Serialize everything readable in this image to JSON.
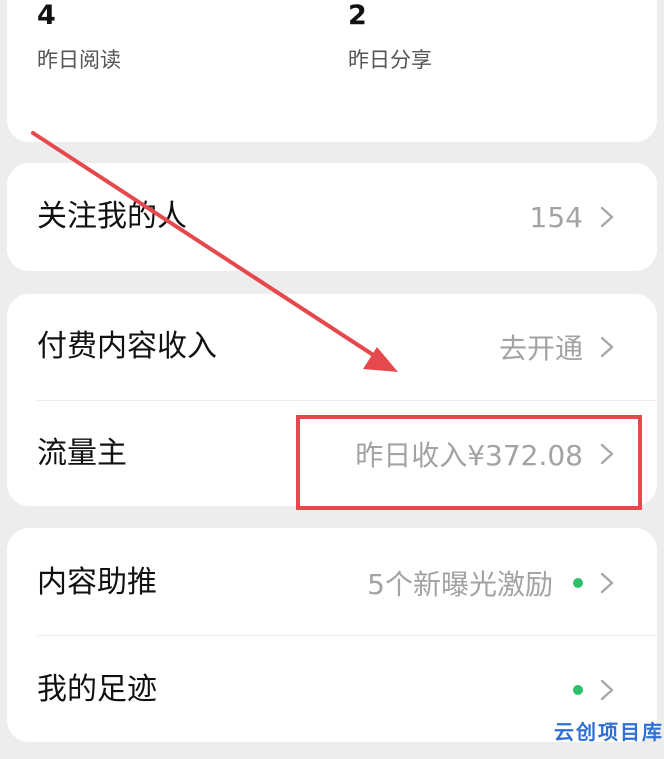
{
  "stats": {
    "reads": {
      "value": "4",
      "label": "昨日阅读"
    },
    "shares": {
      "value": "2",
      "label": "昨日分享"
    }
  },
  "followers": {
    "label": "关注我的人",
    "value": "154"
  },
  "paid_content": {
    "label": "付费内容收入",
    "value": "去开通"
  },
  "traffic_owner": {
    "label": "流量主",
    "value": "昨日收入¥372.08"
  },
  "content_promo": {
    "label": "内容助推",
    "value": "5个新曝光激励"
  },
  "footprint": {
    "label": "我的足迹"
  },
  "watermark": "云创项目库",
  "colors": {
    "background": "#ededed",
    "card": "#ffffff",
    "secondary_text": "#a3a3a3",
    "notification_dot": "#2dbf6b",
    "annotation": "#e5484d"
  }
}
